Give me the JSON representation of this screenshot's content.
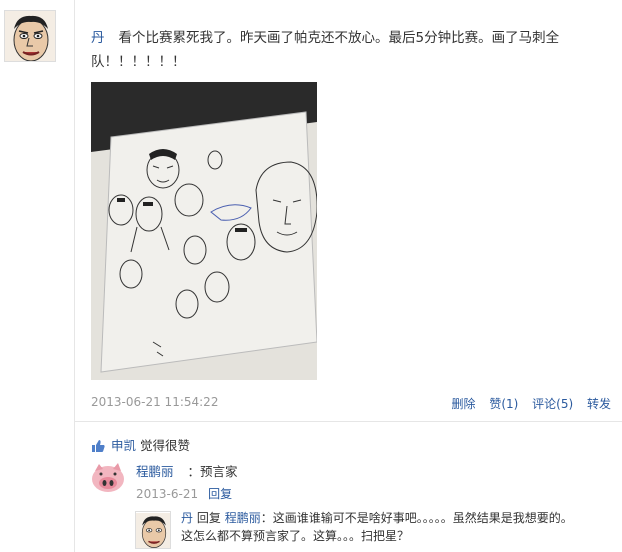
{
  "post": {
    "author": "丹",
    "text": "看个比赛累死我了。昨天画了帕克还不放心。最后5分钟比赛。画了马刺全队！！！！！！",
    "timestamp": "2013-06-21 11:54:22",
    "actions": {
      "delete": "删除",
      "like": "赞(1)",
      "comment": "评论(5)",
      "share": "转发"
    }
  },
  "likes": {
    "name": "申凯",
    "text": "觉得很赞"
  },
  "comment1": {
    "author": "程鹏丽",
    "text": "：预言家",
    "date": "2013-6-21",
    "reply": "回复"
  },
  "comment2": {
    "author": "丹",
    "reply_word": "回复",
    "target": "程鹏丽",
    "line1": "：这画谁谁输可不是啥好事吧。。。。。虽然结果是我想要的。",
    "line2": "这怎么都不算预言家了。这算。。。扫把星？"
  },
  "colors": {
    "link": "#2b5a9e",
    "meta": "#999999",
    "border": "#e6e6e6"
  }
}
